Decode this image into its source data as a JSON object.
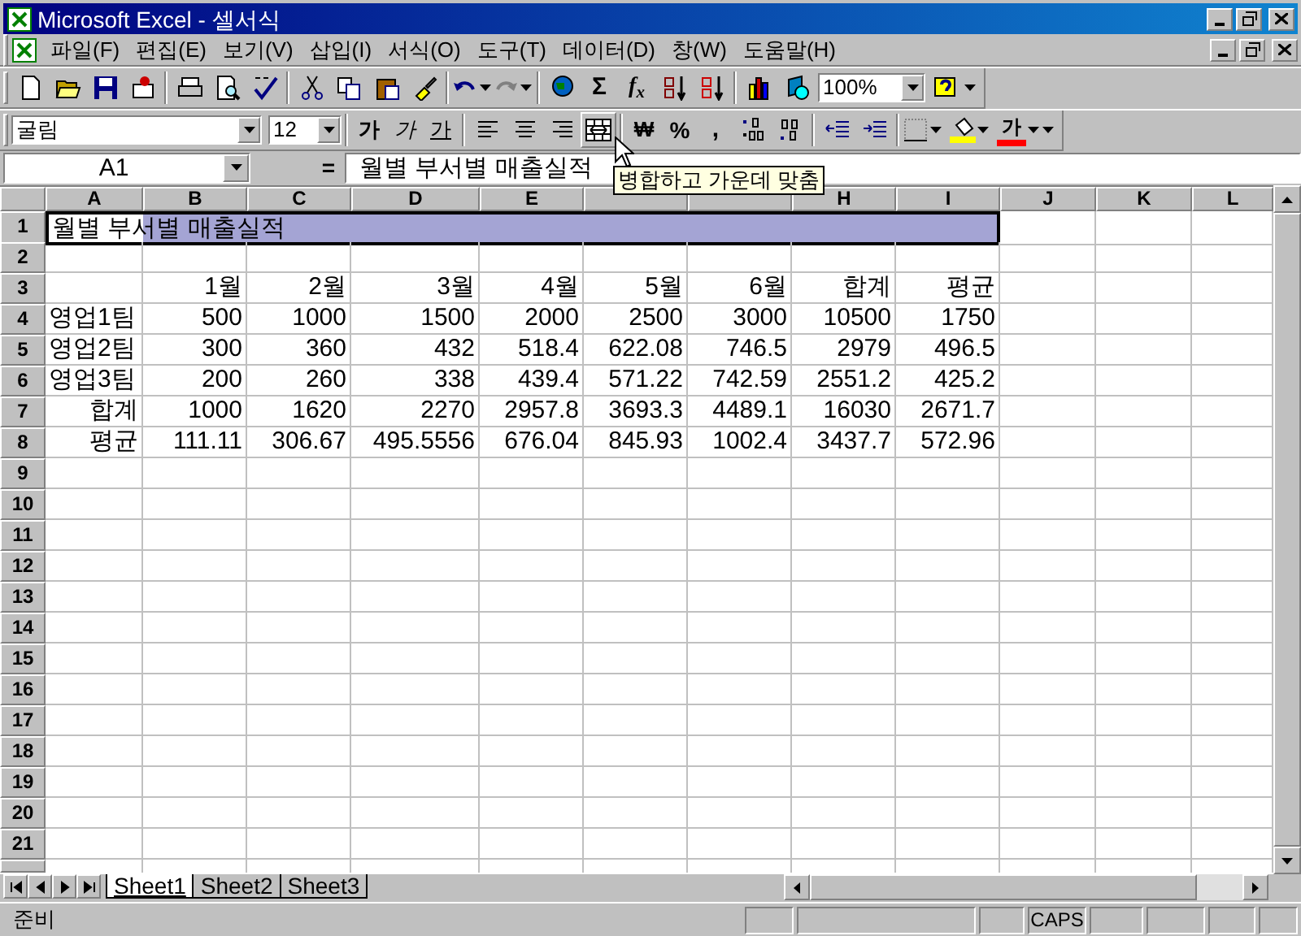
{
  "window": {
    "title": "Microsoft Excel - 셀서식"
  },
  "menu": [
    "파일(F)",
    "편집(E)",
    "보기(V)",
    "삽입(I)",
    "서식(O)",
    "도구(T)",
    "데이터(D)",
    "창(W)",
    "도움말(H)"
  ],
  "standard_toolbar": {
    "sum": "Σ",
    "function": "f$_{x}$",
    "zoom": "100%"
  },
  "formatting_toolbar": {
    "font": "굴림",
    "size": "12",
    "bold": "가",
    "italic": "가",
    "underline": "가",
    "merge_hovered": true,
    "currency": "₩",
    "percent": "%",
    "comma": ",",
    "font_color": "가"
  },
  "formula_bar": {
    "name_box": "A1",
    "equals": "=",
    "content": "월별 부서별 매출실적"
  },
  "tooltip": "병합하고 가운데 맞춤",
  "sheet": {
    "columns": [
      "A",
      "B",
      "C",
      "D",
      "E",
      null,
      null,
      "H",
      "I",
      "J",
      "K",
      "L"
    ],
    "title": {
      "text": "월별 부서별 매출실적",
      "selected": true
    },
    "rows": [
      {
        "number": "1",
        "kind": "title"
      },
      {
        "number": "2",
        "kind": "blank"
      },
      {
        "number": "3",
        "kind": "header",
        "cells": [
          null,
          "1월",
          "2월",
          "3월",
          "4월",
          "5월",
          "6월",
          "합계",
          "평균"
        ]
      },
      {
        "number": "4",
        "kind": "item",
        "cells": [
          "영업1팀",
          "500",
          "1000",
          "1500",
          "2000",
          "2500",
          "3000",
          "10500",
          "1750"
        ]
      },
      {
        "number": "5",
        "kind": "item",
        "cells": [
          "영업2팀",
          "300",
          "360",
          "432",
          "518.4",
          "622.08",
          "746.5",
          "2979",
          "496.5"
        ]
      },
      {
        "number": "6",
        "kind": "item",
        "cells": [
          "영업3팀",
          "200",
          "260",
          "338",
          "439.4",
          "571.22",
          "742.59",
          "2551.2",
          "425.2"
        ]
      },
      {
        "number": "7",
        "kind": "summary",
        "cells": [
          "합계",
          "1000",
          "1620",
          "2270",
          "2957.8",
          "3693.3",
          "4489.1",
          "16030",
          "2671.7"
        ]
      },
      {
        "number": "8",
        "kind": "summary",
        "cells": [
          "평균",
          "111.11",
          "306.67",
          "495.5556",
          "676.04",
          "845.93",
          "1002.4",
          "3437.7",
          "572.96"
        ]
      },
      {
        "number": "9",
        "kind": "blank"
      },
      {
        "number": "10",
        "kind": "blank"
      },
      {
        "number": "11",
        "kind": "blank"
      },
      {
        "number": "12",
        "kind": "blank"
      },
      {
        "number": "13",
        "kind": "blank"
      },
      {
        "number": "14",
        "kind": "blank"
      },
      {
        "number": "15",
        "kind": "blank"
      },
      {
        "number": "16",
        "kind": "blank"
      },
      {
        "number": "17",
        "kind": "blank"
      },
      {
        "number": "18",
        "kind": "blank"
      },
      {
        "number": "19",
        "kind": "blank"
      },
      {
        "number": "20",
        "kind": "blank"
      },
      {
        "number": "21",
        "kind": "blank"
      }
    ]
  },
  "sheet_tabs": [
    {
      "label": "Sheet1",
      "selected": true
    },
    {
      "label": "Sheet2",
      "selected": false
    },
    {
      "label": "Sheet3",
      "selected": false
    }
  ],
  "status_bar": {
    "text": "준비",
    "indicators": [
      "CAPS"
    ]
  }
}
